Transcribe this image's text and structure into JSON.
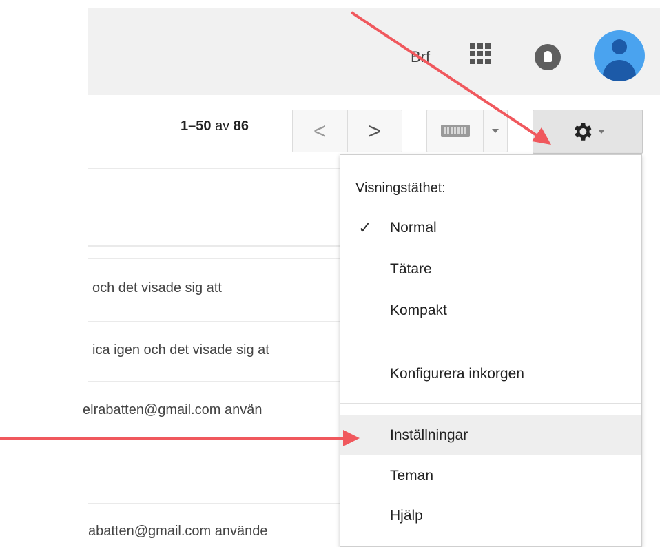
{
  "header": {
    "account_label": "Brf",
    "icons": [
      "apps-grid-icon",
      "notifications-icon",
      "avatar"
    ]
  },
  "toolbar": {
    "pagination": {
      "range": "1–50",
      "of": "av",
      "total": "86"
    },
    "prev_glyph": "<",
    "next_glyph": ">",
    "settings_icon": "gear-icon"
  },
  "email_snippets": [
    "och det visade sig att",
    "ica igen och det visade sig at",
    "elrabatten@gmail.com använ",
    "abatten@gmail.com använde"
  ],
  "settings_menu": {
    "heading": "Visningstäthet:",
    "density_options": [
      {
        "label": "Normal",
        "checked": true
      },
      {
        "label": "Tätare",
        "checked": false
      },
      {
        "label": "Kompakt",
        "checked": false
      }
    ],
    "configure_label": "Konfigurera inkorgen",
    "items": [
      {
        "label": "Inställningar",
        "highlighted": true
      },
      {
        "label": "Teman",
        "highlighted": false
      },
      {
        "label": "Hjälp",
        "highlighted": false
      }
    ],
    "checkmark_glyph": "✓"
  },
  "colors": {
    "annotation_arrow": "#f0585d",
    "topbar": "#f1f1f1",
    "avatar": "#4aa3ef"
  }
}
